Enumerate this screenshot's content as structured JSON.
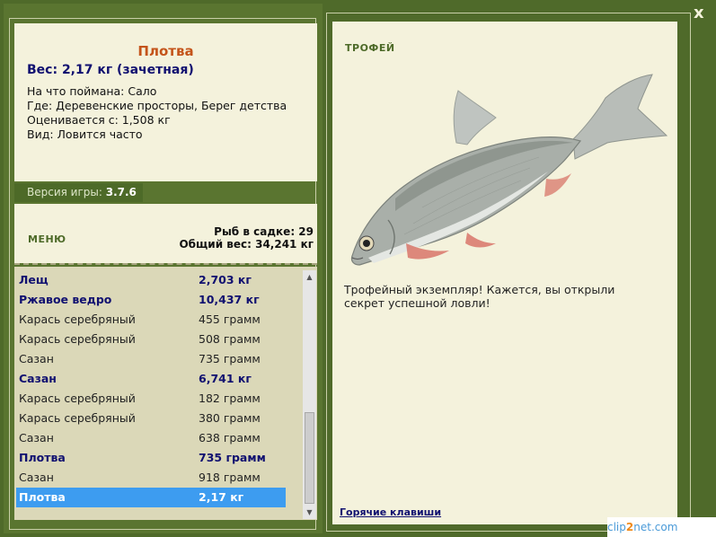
{
  "close_label": "x",
  "fish_info": {
    "title": "Плотва",
    "weight_line": "Вес: 2,17 кг (зачетная)",
    "caught_on": "На что поймана: Сало",
    "location": "Где: Деревенские просторы, Берег детства",
    "valued_from": "Оценивается с: 1,508 кг",
    "kind": "Вид: Ловится часто"
  },
  "version": {
    "label": "Версия игры:",
    "value": "3.7.6"
  },
  "menu": {
    "label": "МЕНЮ",
    "keepnet_count": "Рыб в садке: 29",
    "total_weight": "Общий вес: 34,241 кг"
  },
  "catch_list": [
    {
      "name": "Лещ",
      "weight": "2,703 кг",
      "bold": true,
      "selected": false
    },
    {
      "name": "Ржавое ведро",
      "weight": "10,437 кг",
      "bold": true,
      "selected": false
    },
    {
      "name": "Карась серебряный",
      "weight": "455 грамм",
      "bold": false,
      "selected": false
    },
    {
      "name": "Карась серебряный",
      "weight": "508 грамм",
      "bold": false,
      "selected": false
    },
    {
      "name": "Сазан",
      "weight": "735 грамм",
      "bold": false,
      "selected": false
    },
    {
      "name": "Сазан",
      "weight": "6,741 кг",
      "bold": true,
      "selected": false
    },
    {
      "name": "Карась серебряный",
      "weight": "182 грамм",
      "bold": false,
      "selected": false
    },
    {
      "name": "Карась серебряный",
      "weight": "380 грамм",
      "bold": false,
      "selected": false
    },
    {
      "name": "Сазан",
      "weight": "638 грамм",
      "bold": false,
      "selected": false
    },
    {
      "name": "Плотва",
      "weight": "735 грамм",
      "bold": true,
      "selected": false
    },
    {
      "name": "Сазан",
      "weight": "918 грамм",
      "bold": false,
      "selected": false
    },
    {
      "name": "Плотва",
      "weight": "2,17 кг",
      "bold": true,
      "selected": true
    }
  ],
  "trophy": {
    "label": "ТРОФЕЙ",
    "description": "Трофейный экземпляр! Кажется, вы открыли секрет успешной ловли!",
    "hotkeys": "Горячие клавиши"
  },
  "watermark": {
    "part1": "clip",
    "part2": "2",
    "part3": "net.com"
  },
  "colors": {
    "background": "#4f6a2a",
    "panel": "#f4f2dc",
    "list_bg": "#dbd8b8",
    "title": "#c4541a",
    "bold_text": "#101070",
    "selected": "#3d9cf0"
  }
}
